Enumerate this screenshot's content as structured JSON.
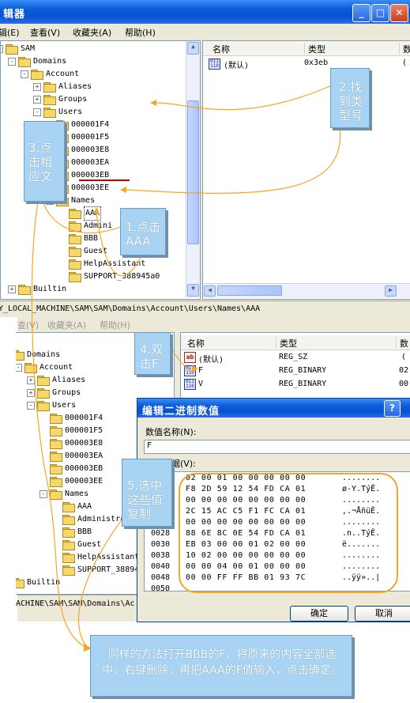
{
  "window1": {
    "title_fragment": "辑器",
    "menu": [
      "辑(E)",
      "查看(V)",
      "收藏夹(A)",
      "帮助(H)"
    ],
    "tree": [
      {
        "label": "SAM",
        "level": 0,
        "expander": "-"
      },
      {
        "label": "Domains",
        "level": 1,
        "expander": "-"
      },
      {
        "label": "Account",
        "level": 2,
        "expander": "-"
      },
      {
        "label": "Aliases",
        "level": 3,
        "expander": "+"
      },
      {
        "label": "Groups",
        "level": 3,
        "expander": "+"
      },
      {
        "label": "Users",
        "level": 3,
        "expander": "-"
      },
      {
        "label": "000001F4",
        "level": 4,
        "expander": ""
      },
      {
        "label": "000001F5",
        "level": 4,
        "expander": ""
      },
      {
        "label": "000003E8",
        "level": 4,
        "expander": ""
      },
      {
        "label": "000003EA",
        "level": 4,
        "expander": ""
      },
      {
        "label": "000003EB",
        "level": 4,
        "expander": ""
      },
      {
        "label": "000003EE",
        "level": 4,
        "expander": ""
      },
      {
        "label": "Names",
        "level": 4,
        "expander": "-"
      },
      {
        "label": "AAA",
        "level": 5,
        "expander": ""
      },
      {
        "label": "Admini",
        "level": 5,
        "expander": ""
      },
      {
        "label": "BBB",
        "level": 5,
        "expander": ""
      },
      {
        "label": "Guest",
        "level": 5,
        "expander": ""
      },
      {
        "label": "HelpAssistant",
        "level": 5,
        "expander": ""
      },
      {
        "label": "SUPPORT_388945a0",
        "level": 5,
        "expander": ""
      },
      {
        "label": "Builtin",
        "level": 1,
        "expander": "+"
      }
    ],
    "columns": [
      "名称",
      "类型",
      "数"
    ],
    "values": [
      {
        "name": "(默认)",
        "type": "0x3eb",
        "data": "("
      }
    ],
    "status_path": "Y_LOCAL_MACHINE\\SAM\\SAM\\Domains\\Account\\Users\\Names\\AAA"
  },
  "window2": {
    "menu": [
      "查(V)",
      "收藏夹(A)",
      "帮助(H)"
    ],
    "tree": [
      {
        "label": "Domains",
        "level": 0,
        "expander": ""
      },
      {
        "label": "Account",
        "level": 1,
        "expander": "-"
      },
      {
        "label": "Aliases",
        "level": 2,
        "expander": "+"
      },
      {
        "label": "Groups",
        "level": 2,
        "expander": "+"
      },
      {
        "label": "Users",
        "level": 2,
        "expander": "-"
      },
      {
        "label": "000001F4",
        "level": 3,
        "expander": ""
      },
      {
        "label": "000001F5",
        "level": 3,
        "expander": ""
      },
      {
        "label": "000003E8",
        "level": 3,
        "expander": ""
      },
      {
        "label": "000003EA",
        "level": 3,
        "expander": ""
      },
      {
        "label": "000003EB",
        "level": 3,
        "expander": ""
      },
      {
        "label": "000003EE",
        "level": 3,
        "expander": ""
      },
      {
        "label": "Names",
        "level": 3,
        "expander": "-"
      },
      {
        "label": "AAA",
        "level": 4,
        "expander": ""
      },
      {
        "label": "Administrat",
        "level": 4,
        "expander": ""
      },
      {
        "label": "BBB",
        "level": 4,
        "expander": ""
      },
      {
        "label": "Guest",
        "level": 4,
        "expander": ""
      },
      {
        "label": "HelpAssistant",
        "level": 4,
        "expander": ""
      },
      {
        "label": "SUPPORT_388945",
        "level": 4,
        "expander": ""
      },
      {
        "label": "Builtin",
        "level": 0,
        "expander": "+"
      }
    ],
    "columns": [
      "名称",
      "类型",
      "数"
    ],
    "values": [
      {
        "name": "(默认)",
        "type": "REG_SZ",
        "data": "(",
        "icon": "ab"
      },
      {
        "name": "F",
        "type": "REG_BINARY",
        "data": "02",
        "icon": "bin"
      },
      {
        "name": "V",
        "type": "REG_BINARY",
        "data": "00",
        "icon": "bin"
      }
    ],
    "status_path": "ACHINE\\SAM\\SAM\\Domains\\Ac"
  },
  "dialog": {
    "title": "编辑二进制数值",
    "value_name_label": "数值名称(N):",
    "value_name": "F",
    "value_data_label": "数值数据(V):",
    "hex_rows": [
      {
        "offset": "",
        "bytes": "02 00 01 00 00 00 00 00",
        "ascii": "........"
      },
      {
        "offset": "",
        "bytes": "F8 2D 59 12 54 FD CA 01",
        "ascii": "ø-Y.TýÊ."
      },
      {
        "offset": "",
        "bytes": "00 00 00 00 00 00 00 00",
        "ascii": "........"
      },
      {
        "offset": "",
        "bytes": "2C 15 AC C5 F1 FC CA 01",
        "ascii": ",.¬ÅñüÊ."
      },
      {
        "offset": "",
        "bytes": "00 00 00 00 00 00 00 00",
        "ascii": "........"
      },
      {
        "offset": "0028",
        "bytes": "88 6E 8C 0E 54 FD CA 01",
        "ascii": ".n..TýÊ."
      },
      {
        "offset": "0030",
        "bytes": "EB 03 00 00 01 02 00 00",
        "ascii": "ë......."
      },
      {
        "offset": "0038",
        "bytes": "10 02 00 00 00 00 00 00",
        "ascii": "........"
      },
      {
        "offset": "0040",
        "bytes": "00 00 04 00 01 00 00 00",
        "ascii": "........"
      },
      {
        "offset": "0048",
        "bytes": "00 00 FF FF BB 01 93 7C",
        "ascii": "..ÿÿ»..|"
      },
      {
        "offset": "0050",
        "bytes": "",
        "ascii": ""
      }
    ],
    "ok_label": "确定",
    "cancel_label": "取消"
  },
  "callouts": {
    "step1": "1.点击\nAAA",
    "step2": "2.找\n到类\n型号",
    "step3": "3.点\n击相\n应文",
    "step4": "4.双\n击F",
    "step5": "5.选中\n这些值\n复制",
    "final": "同样的方法打开BBB的F，将原来的内容全部选中，右键删除，再把AAA的F值输入，点击确定。"
  },
  "colors": {
    "annotation_orange": "#f5a623",
    "callout_blue": "#a9d3f2",
    "underline_red": "#cc0000",
    "titlebar_blue": "#0a5ad8"
  }
}
